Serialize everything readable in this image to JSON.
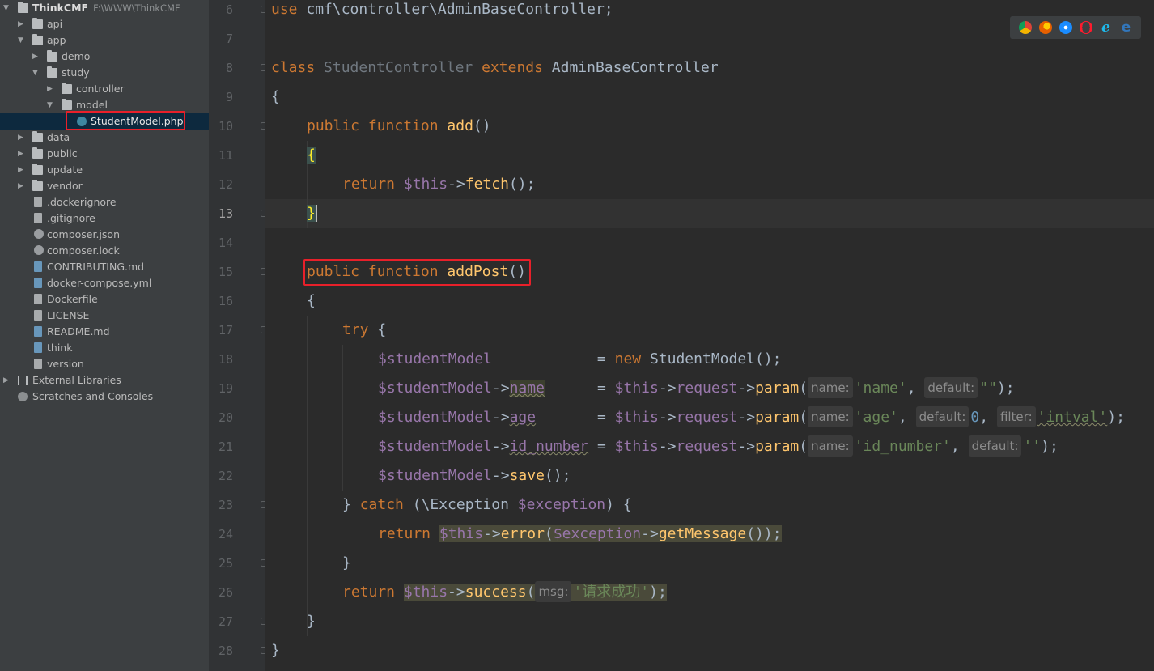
{
  "tree": {
    "project": {
      "name": "ThinkCMF",
      "path": "F:\\WWW\\ThinkCMF"
    },
    "items": [
      {
        "label": "api",
        "kind": "folder",
        "level": 1,
        "expanded": false
      },
      {
        "label": "app",
        "kind": "folder",
        "level": 1,
        "expanded": true
      },
      {
        "label": "demo",
        "kind": "folder",
        "level": 2,
        "expanded": false
      },
      {
        "label": "study",
        "kind": "folder",
        "level": 2,
        "expanded": true
      },
      {
        "label": "controller",
        "kind": "folder",
        "level": 3,
        "expanded": false
      },
      {
        "label": "model",
        "kind": "folder",
        "level": 3,
        "expanded": true
      },
      {
        "label": "StudentModel.php",
        "kind": "class",
        "level": 4,
        "selected": true
      },
      {
        "label": "data",
        "kind": "folder",
        "level": 1,
        "expanded": false
      },
      {
        "label": "public",
        "kind": "folder",
        "level": 1,
        "expanded": false
      },
      {
        "label": "update",
        "kind": "folder",
        "level": 1,
        "expanded": false
      },
      {
        "label": "vendor",
        "kind": "folder",
        "level": 1,
        "expanded": false
      },
      {
        "label": ".dockerignore",
        "kind": "file",
        "level": 1
      },
      {
        "label": ".gitignore",
        "kind": "file",
        "level": 1
      },
      {
        "label": "composer.json",
        "kind": "gear",
        "level": 1
      },
      {
        "label": "composer.lock",
        "kind": "gear",
        "level": 1
      },
      {
        "label": "CONTRIBUTING.md",
        "kind": "md",
        "level": 1
      },
      {
        "label": "docker-compose.yml",
        "kind": "dc",
        "level": 1
      },
      {
        "label": "Dockerfile",
        "kind": "file",
        "level": 1
      },
      {
        "label": "LICENSE",
        "kind": "file",
        "level": 1
      },
      {
        "label": "README.md",
        "kind": "md",
        "level": 1
      },
      {
        "label": "think",
        "kind": "php",
        "level": 1
      },
      {
        "label": "version",
        "kind": "file",
        "level": 1
      },
      {
        "label": "External Libraries",
        "kind": "lib",
        "level": 0,
        "expanded": false
      },
      {
        "label": "Scratches and Consoles",
        "kind": "scratch",
        "level": 0
      }
    ]
  },
  "editor": {
    "current_line": "13",
    "lines": [
      "6",
      "7",
      "8",
      "9",
      "10",
      "11",
      "12",
      "13",
      "14",
      "15",
      "16",
      "17",
      "18",
      "19",
      "20",
      "21",
      "22",
      "23",
      "24",
      "25",
      "26",
      "27",
      "28"
    ],
    "code": {
      "l6": [
        "use",
        " cmf\\controller\\AdminBaseController;"
      ],
      "l8": [
        "class",
        " StudentController ",
        "extends",
        " AdminBaseController"
      ],
      "l9": "{",
      "l10": [
        "public function ",
        "add",
        "()"
      ],
      "l11": "{",
      "l12": [
        "return ",
        "$this",
        "->",
        "fetch",
        "();"
      ],
      "l13": "}",
      "l15": [
        "public function ",
        "addPost",
        "()"
      ],
      "l16": "{",
      "l17": [
        "try",
        " {"
      ],
      "l18": [
        "$studentModel",
        "            = ",
        "new",
        " StudentModel();"
      ],
      "l19": [
        "$studentModel",
        "->",
        "name",
        "      = ",
        "$this",
        "->",
        "request",
        "->",
        "param",
        "(",
        "name:",
        "'name'",
        ", ",
        "default:",
        "\"\"",
        ");"
      ],
      "l20": [
        "$studentModel",
        "->",
        "age",
        "       = ",
        "$this",
        "->",
        "request",
        "->",
        "param",
        "(",
        "name:",
        "'age'",
        ", ",
        "default:",
        "0",
        ", ",
        "filter:",
        "'intval'",
        ");"
      ],
      "l21": [
        "$studentModel",
        "->",
        "id_number",
        " = ",
        "$this",
        "->",
        "request",
        "->",
        "param",
        "(",
        "name:",
        "'id_number'",
        ", ",
        "default:",
        "''",
        ");"
      ],
      "l22": [
        "$studentModel",
        "->",
        "save",
        "();"
      ],
      "l23": [
        "} ",
        "catch",
        " (\\Exception ",
        "$exception",
        ") {"
      ],
      "l24": [
        "return ",
        "$this",
        "->",
        "error",
        "(",
        "$exception",
        "->",
        "getMessage",
        "());"
      ],
      "l25": "}",
      "l26": [
        "return ",
        "$this",
        "->",
        "success",
        "(",
        "msg:",
        "'请求成功'",
        ");"
      ],
      "l27": "}",
      "l28": "}"
    }
  },
  "browsers": [
    "chrome-icon",
    "firefox-icon",
    "safari-icon",
    "opera-icon",
    "ie-icon",
    "edge-icon"
  ],
  "colors": {
    "keyword": "#cc7832",
    "function": "#ffc66d",
    "variable": "#9876aa",
    "string": "#6a8759",
    "number": "#6897bb",
    "text": "#a9b7c6",
    "highlight_box": "#e8202a"
  }
}
